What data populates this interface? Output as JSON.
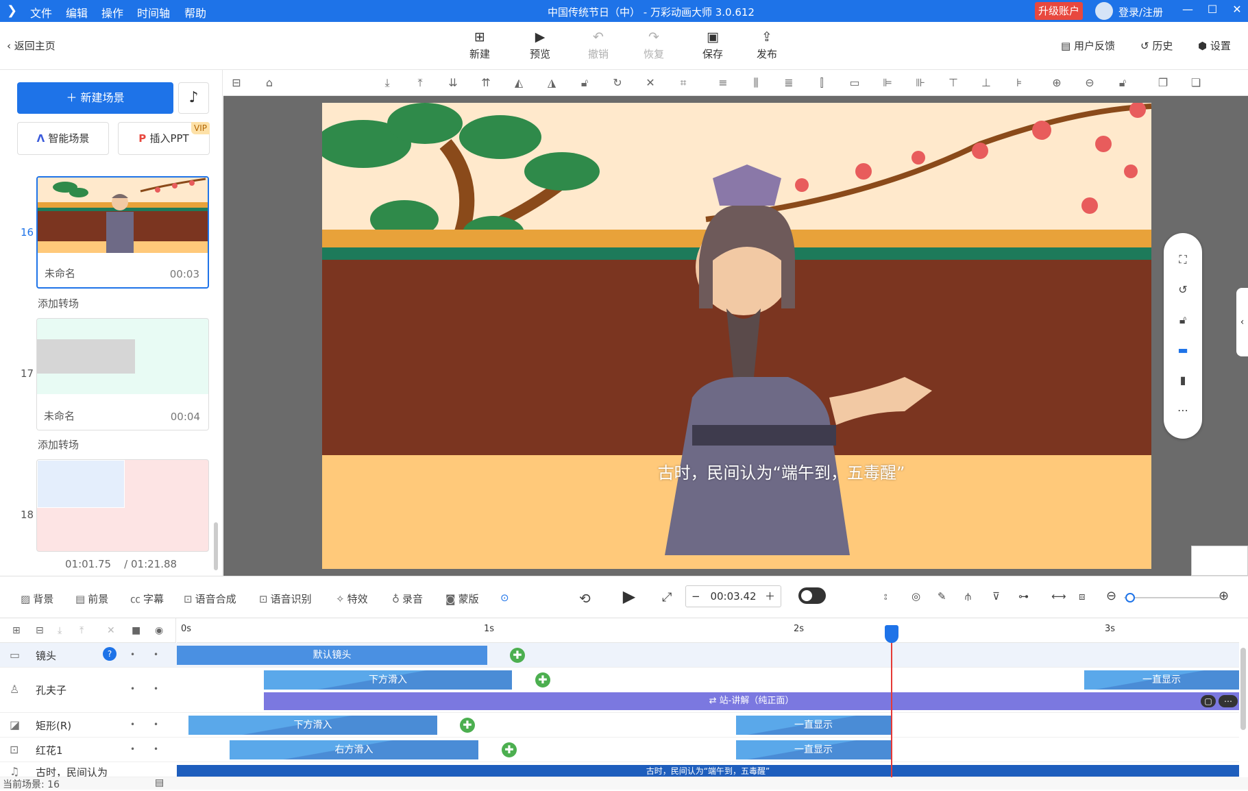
{
  "titlebar": {
    "menu": [
      "文件",
      "编辑",
      "操作",
      "时间轴",
      "帮助"
    ],
    "title": "中国传统节日（中） - 万彩动画大师 3.0.612",
    "upgrade": "升级账户",
    "login": "登录/注册"
  },
  "toolbar": {
    "back": "返回主页",
    "buttons": [
      {
        "label": "新建",
        "icon": "plus-box-icon"
      },
      {
        "label": "预览",
        "icon": "play-icon"
      },
      {
        "label": "撤销",
        "icon": "undo-icon"
      },
      {
        "label": "恢复",
        "icon": "redo-icon"
      },
      {
        "label": "保存",
        "icon": "save-icon"
      },
      {
        "label": "发布",
        "icon": "publish-icon"
      }
    ],
    "feedback": "用户反馈",
    "history": "历史",
    "settings": "设置"
  },
  "sidebar": {
    "new_scene": "新建场景",
    "smart_scene": "智能场景",
    "insert_ppt": "插入PPT",
    "vip": "VIP",
    "scenes": [
      {
        "num": "16",
        "name": "未命名",
        "duration": "00:03",
        "selected": true
      },
      {
        "num": "17",
        "name": "未命名",
        "duration": "00:04",
        "selected": false
      },
      {
        "num": "18",
        "name": "",
        "duration": "",
        "selected": false
      }
    ],
    "add_transition": "添加转场",
    "time_current": "01:01.75",
    "time_total": "/ 01:21.88"
  },
  "canvas": {
    "subtitle": "古时，民间认为“端午到，五毒醒”",
    "camera_label": "默认镜头"
  },
  "bottombar": {
    "tools": [
      "背景",
      "前景",
      "字幕",
      "语音合成",
      "语音识别",
      "特效",
      "录音",
      "蒙版"
    ],
    "time": "00:03.42"
  },
  "timeline": {
    "ticks": [
      "0s",
      "1s",
      "2s",
      "3s"
    ],
    "rows": [
      {
        "label": "镜头",
        "icon": "camera-icon"
      },
      {
        "label": "孔夫子",
        "icon": "person-icon"
      },
      {
        "label": "矩形(R)",
        "icon": "shape-icon"
      },
      {
        "label": "红花1",
        "icon": "image-icon"
      },
      {
        "label": "古时，民间认为",
        "icon": "audio-icon"
      }
    ],
    "clips": {
      "camera": "默认镜头",
      "slide_up": "下方滑入",
      "always_show": "一直显示",
      "stand_talk": "站-讲解（纯正面）",
      "slide_right": "右方滑入"
    },
    "audio_label": "古时，民间认为“端午到，五毒醒”"
  },
  "status": {
    "current_scene": "当前场景: 16"
  },
  "colors": {
    "accent": "#1e73e8",
    "upgrade": "#e8483e",
    "clip_blue": "#4a90e2",
    "clip_purple": "#7b78e0",
    "keyframe_green": "#4caf50",
    "playhead": "#e53935"
  }
}
